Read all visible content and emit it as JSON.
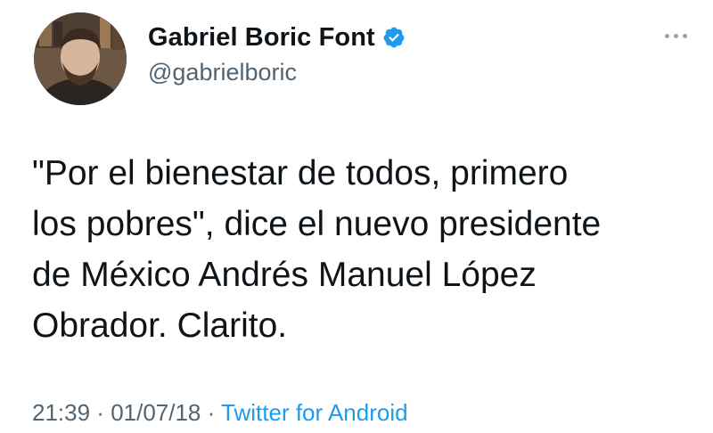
{
  "author": {
    "display_name": "Gabriel Boric Font",
    "handle": "@gabrielboric",
    "verified": true,
    "avatar_icon": "profile-photo"
  },
  "tweet": {
    "text": "\"Por el bienestar de todos, primero\nlos pobres\", dice el nuevo presidente\nde México Andrés Manuel López\nObrador. Clarito."
  },
  "meta": {
    "time": "21:39",
    "separator": " · ",
    "date": "01/07/18",
    "source": "Twitter for Android"
  },
  "icons": {
    "more": "more-options-icon",
    "verified": "verified-badge-icon"
  },
  "colors": {
    "accent": "#1d9bf0",
    "secondary_text": "#536471",
    "primary_text": "#0f1419"
  }
}
